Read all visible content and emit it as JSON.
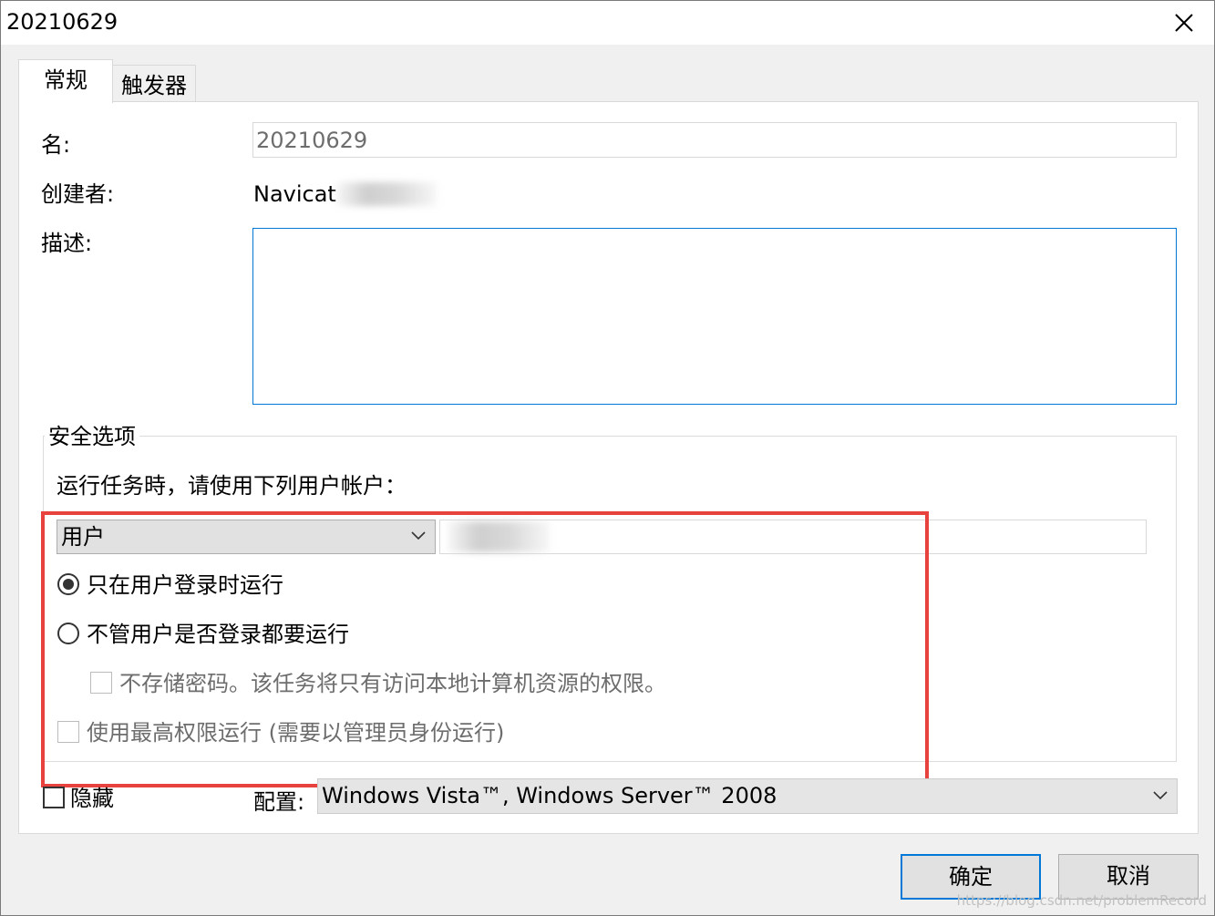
{
  "window": {
    "title": "20210629",
    "close_icon": "close-icon"
  },
  "tabs": [
    {
      "label": "常规",
      "active": true
    },
    {
      "label": "触发器",
      "active": false
    }
  ],
  "general": {
    "name_label": "名:",
    "name_value": "20210629",
    "creator_label": "创建者:",
    "creator_value": "Navicat",
    "description_label": "描述:",
    "description_value": ""
  },
  "security": {
    "group_title": "安全选项",
    "run_as_label": "运行任务時，请使用下列用户帐户：",
    "account_type": "用户",
    "account_value": "",
    "radio_logged_on": "只在用户登录时运行",
    "radio_logged_on_selected": true,
    "radio_whether_logged": "不管用户是否登录都要运行",
    "radio_whether_logged_selected": false,
    "checkbox_no_password": "不存储密码。该任务将只有访问本地计算机资源的权限。",
    "checkbox_no_password_checked": false,
    "checkbox_highest": "使用最高权限运行 (需要以管理员身份运行)",
    "checkbox_highest_checked": false
  },
  "hidden_label": "隐藏",
  "hidden_checked": false,
  "config_label": "配置:",
  "config_value": "Windows Vista™, Windows Server™ 2008",
  "buttons": {
    "ok": "确定",
    "cancel": "取消"
  },
  "watermark": "https://blog.csdn.net/problemRecord",
  "colors": {
    "highlight": "#e8423e",
    "accent": "#0078d7"
  }
}
